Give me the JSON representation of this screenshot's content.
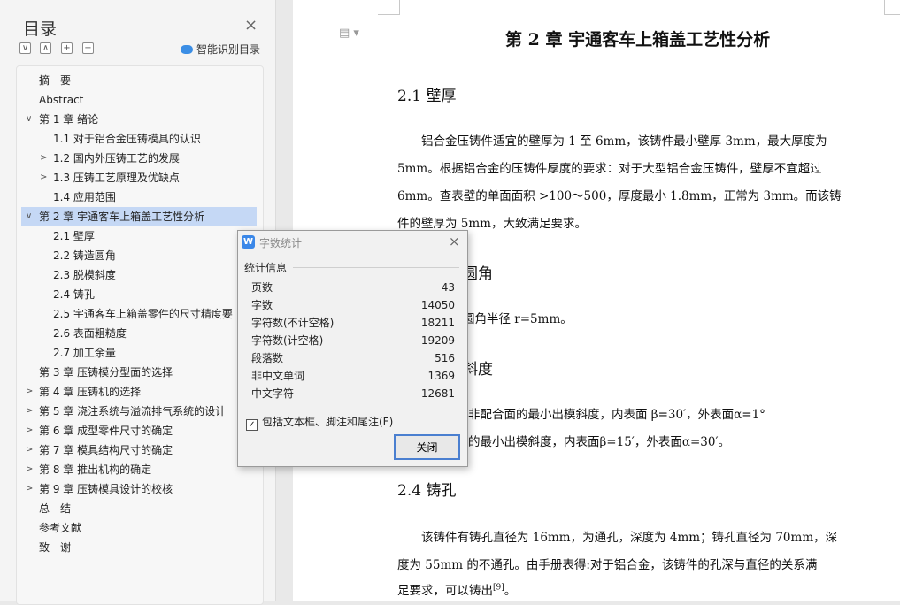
{
  "sidebar": {
    "title": "目录",
    "close_icon": "×",
    "toolbar": {
      "collapse_icon": "∨",
      "expand_icon": "∧",
      "plus_icon": "+",
      "minus_icon": "−"
    },
    "smart_label": "智能识别目录",
    "items": [
      {
        "label": "摘　要",
        "indent": 0,
        "chevron": ""
      },
      {
        "label": "Abstract",
        "indent": 0,
        "chevron": ""
      },
      {
        "label": "第 1 章  绪论",
        "indent": 0,
        "chevron": "∨"
      },
      {
        "label": "1.1  对于铝合金压铸模具的认识",
        "indent": 1,
        "chevron": ""
      },
      {
        "label": "1.2  国内外压铸工艺的发展",
        "indent": 1,
        "chevron": ">"
      },
      {
        "label": "1.3  压铸工艺原理及优缺点",
        "indent": 1,
        "chevron": ">"
      },
      {
        "label": "1.4  应用范围",
        "indent": 1,
        "chevron": ""
      },
      {
        "label": "第 2 章  宇通客车上箱盖工艺性分析",
        "indent": 0,
        "chevron": "∨",
        "selected": true
      },
      {
        "label": "2.1 壁厚",
        "indent": 1,
        "chevron": ""
      },
      {
        "label": "2.2 铸造圆角",
        "indent": 1,
        "chevron": ""
      },
      {
        "label": "2.3 脱模斜度",
        "indent": 1,
        "chevron": ""
      },
      {
        "label": "2.4 铸孔",
        "indent": 1,
        "chevron": ""
      },
      {
        "label": "2.5 宇通客车上箱盖零件的尺寸精度要 ...",
        "indent": 1,
        "chevron": ""
      },
      {
        "label": "2.6 表面粗糙度",
        "indent": 1,
        "chevron": ""
      },
      {
        "label": "2.7 加工余量",
        "indent": 1,
        "chevron": ""
      },
      {
        "label": "第 3 章  压铸模分型面的选择",
        "indent": 0,
        "chevron": ""
      },
      {
        "label": "第 4 章  压铸机的选择",
        "indent": 0,
        "chevron": ">"
      },
      {
        "label": "第 5 章  浇注系统与溢流排气系统的设计",
        "indent": 0,
        "chevron": ">"
      },
      {
        "label": "第 6 章  成型零件尺寸的确定",
        "indent": 0,
        "chevron": ">"
      },
      {
        "label": "第 7 章  模具结构尺寸的确定",
        "indent": 0,
        "chevron": ">"
      },
      {
        "label": "第 8 章  推出机构的确定",
        "indent": 0,
        "chevron": ">"
      },
      {
        "label": "第 9 章  压铸模具设计的校核",
        "indent": 0,
        "chevron": ">"
      },
      {
        "label": "总　结",
        "indent": 0,
        "chevron": ""
      },
      {
        "label": "参考文献",
        "indent": 0,
        "chevron": ""
      },
      {
        "label": "致　谢",
        "indent": 0,
        "chevron": ""
      }
    ]
  },
  "document": {
    "icon": "▤ ▾",
    "chapter_title": "第 2 章  宇通客车上箱盖工艺性分析",
    "s21_heading": "2.1 壁厚",
    "s21_lines": [
      "　　铝合金压铸件适宜的壁厚为 1 至 6mm，该铸件最小壁厚 3mm，最大厚度为",
      "5mm。根据铝合金的压铸件厚度的要求：对于大型铝合金压铸件，壁厚不宜超过",
      "6mm。查表壁的单面面积 >100～500，厚度最小 1.8mm，正常为 3mm。而该铸",
      "件的壁厚为 5mm，大致满足要求。"
    ],
    "s22_heading_visible": "圆角",
    "s22_line_visible": "圆角半径 r=5mm。",
    "s23_heading_visible": "斜度",
    "s23_lines_visible": [
      "非配合面的最小出模斜度，内表面  β=30′，外表面α=1°",
      "的最小出模斜度，内表面β=15′，外表面α=30′。"
    ],
    "s24_heading": "2.4 铸孔",
    "s24_lines": [
      "　　该铸件有铸孔直径为 16mm，为通孔，深度为 4mm；铸孔直径为 70mm，深",
      "度为 55mm 的不通孔。由手册表得:对于铝合金，该铸件的孔深与直径的关系满",
      "足要求，可以铸出",
      "[9]",
      "。"
    ]
  },
  "dialog": {
    "icon": "W",
    "title": "字数统计",
    "close_icon": "×",
    "group_label": "统计信息",
    "stats": [
      {
        "label": "页数",
        "value": "43"
      },
      {
        "label": "字数",
        "value": "14050"
      },
      {
        "label": "字符数(不计空格)",
        "value": "18211"
      },
      {
        "label": "字符数(计空格)",
        "value": "19209"
      },
      {
        "label": "段落数",
        "value": "516"
      },
      {
        "label": "非中文单词",
        "value": "1369"
      },
      {
        "label": "中文字符",
        "value": "12681"
      }
    ],
    "checkbox_checked": "✓",
    "checkbox_label": "包括文本框、脚注和尾注(F)",
    "button_label": "关闭"
  }
}
